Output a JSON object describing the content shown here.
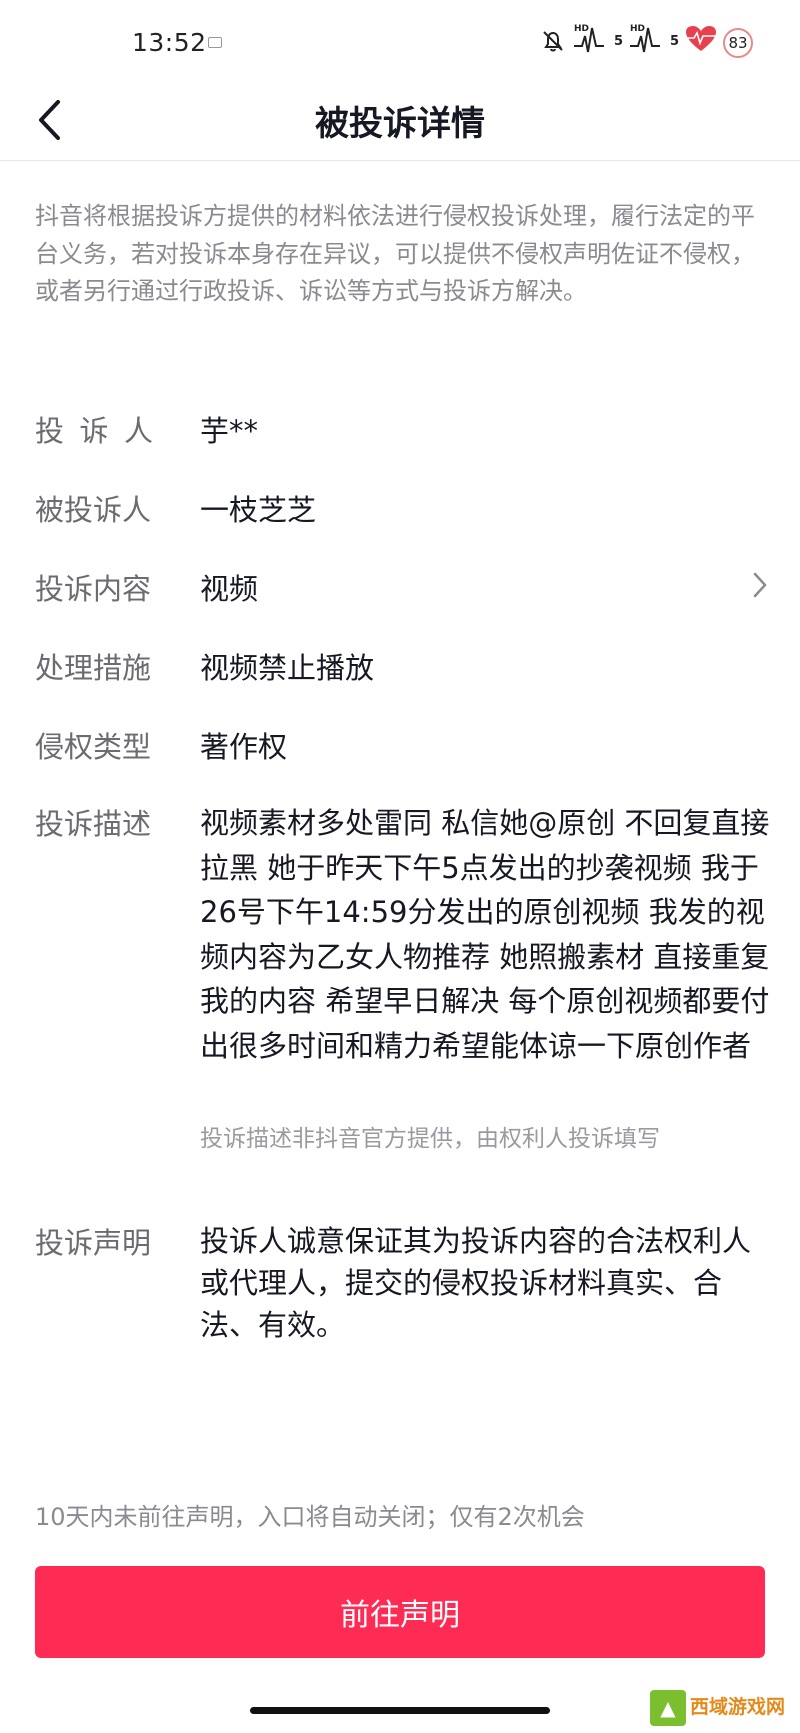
{
  "status_bar": {
    "time": "13:52",
    "signal_tag": "HD",
    "signal_number": "5",
    "battery": "83"
  },
  "header": {
    "title": "被投诉详情",
    "back_icon": "chevron-left-icon"
  },
  "notice": "抖音将根据投诉方提供的材料依法进行侵权投诉处理，履行法定的平台义务，若对投诉本身存在异议，可以提供不侵权声明佐证不侵权，或者另行通过行政投诉、诉讼等方式与投诉方解决。",
  "details": {
    "complainant": {
      "label": "投诉人",
      "value": "芋**"
    },
    "respondent": {
      "label": "被投诉人",
      "value": "一枝芝芝"
    },
    "content": {
      "label": "投诉内容",
      "value": "视频"
    },
    "measure": {
      "label": "处理措施",
      "value": "视频禁止播放"
    },
    "type": {
      "label": "侵权类型",
      "value": "著作权"
    },
    "description": {
      "label": "投诉描述",
      "value": "视频素材多处雷同 私信她@原创 不回复直接拉黑 她于昨天下午5点发出的抄袭视频 我于26号下午14:59分发出的原创视频 我发的视频内容为乙女人物推荐 她照搬素材 直接重复我的内容 希望早日解决 每个原创视频都要付出很多时间和精力希望能体谅一下原创作者",
      "note": "投诉描述非抖音官方提供，由权利人投诉填写"
    },
    "statement": {
      "label": "投诉声明",
      "value": "投诉人诚意保证其为投诉内容的合法权利人或代理人，提交的侵权投诉材料真实、合法、有效。"
    }
  },
  "footer": {
    "expire_note": "10天内未前往声明，入口将自动关闭；仅有2次机会",
    "button_label": "前往声明"
  },
  "watermark": {
    "text": "西域游戏网"
  },
  "colors": {
    "accent": "#fe2c55",
    "text_primary": "#161823",
    "text_secondary": "#8a8b91"
  }
}
